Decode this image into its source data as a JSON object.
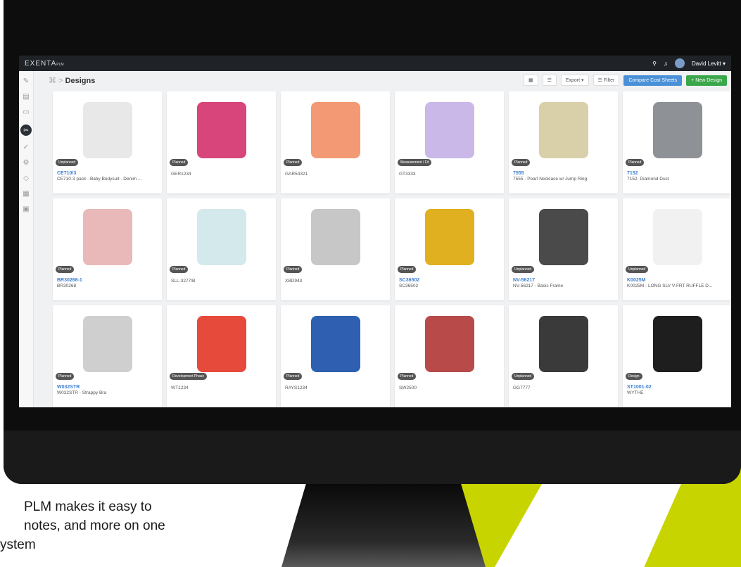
{
  "colors": {
    "accent_blue": "#4a90d9",
    "accent_green": "#3aa74a",
    "stripe": "#c8d400",
    "badge": "#555555"
  },
  "app": {
    "logo": "EXENTA",
    "logo_sub": "PLM",
    "user": "David Levitt ▾"
  },
  "breadcrumb": {
    "icon": "⌘",
    "sep": ">",
    "title": "Designs"
  },
  "toolbar": {
    "grid_icon": "▦",
    "list_icon": "☰",
    "export": "Export ▾",
    "filter": "☰ Filter",
    "compare": "Compare Cost Sheets",
    "new_design": "+ New Design"
  },
  "sidebar": {
    "icons": [
      "pen-icon",
      "docs-icon",
      "image-icon",
      "scissors-icon",
      "check-icon",
      "gear-icon",
      "tag-icon",
      "grid-icon",
      "report-icon"
    ]
  },
  "caption": {
    "line1": "PLM makes it easy to",
    "line2": "notes, and more on one",
    "line3": "ystem"
  },
  "cards": [
    {
      "badge": "Unplanned",
      "code": "CE710/3",
      "desc": "CE710-3 pack - Baby Bodysuit - Denim ...",
      "color": "#e8e8e8"
    },
    {
      "badge": "Planned",
      "code": "",
      "desc": "GER1234",
      "color": "#d8457a"
    },
    {
      "badge": "Planned",
      "code": "",
      "desc": "GAR54321",
      "color": "#f39a74"
    },
    {
      "badge": "Measurement / Fit",
      "code": "",
      "desc": "GT3333",
      "color": "#c9b8e8"
    },
    {
      "badge": "Planned",
      "code": "7555",
      "desc": "7555 - Pearl Necklace w/ Jump Ring",
      "color": "#d9cfa8"
    },
    {
      "badge": "Planned",
      "code": "7152",
      "desc": "7152- Diamond Dust",
      "color": "#8e9196"
    },
    {
      "badge": "Planned",
      "code": "BR30268-1",
      "desc": "BR30268",
      "color": "#e9b8b8"
    },
    {
      "badge": "Planned",
      "code": "",
      "desc": "SLL-3277/B",
      "color": "#d4e9ec"
    },
    {
      "badge": "Planned",
      "code": "",
      "desc": "XBD943",
      "color": "#c7c7c7"
    },
    {
      "badge": "Planned",
      "code": "SC36502",
      "desc": "SC36502",
      "color": "#e0b020"
    },
    {
      "badge": "Unplanned",
      "code": "NV-56217",
      "desc": "NV-56217 - Basic Frame",
      "color": "#4a4a4a"
    },
    {
      "badge": "Unplanned",
      "code": "K0025M",
      "desc": "K0025M - LONG SLV V-FRT RUFFLE D...",
      "color": "#f1f1f1"
    },
    {
      "badge": "Planned",
      "code": "W032STR",
      "desc": "W032STR - Strappy Bra",
      "color": "#cfcfcf"
    },
    {
      "badge": "Development Phase",
      "code": "",
      "desc": "WT1234",
      "color": "#e64a3b"
    },
    {
      "badge": "Planned",
      "code": "",
      "desc": "RAYS1234",
      "color": "#2f5fb0"
    },
    {
      "badge": "Planned",
      "code": "",
      "desc": "SW2500",
      "color": "#b84a4a"
    },
    {
      "badge": "Unplanned",
      "code": "",
      "desc": "GG7777",
      "color": "#3a3a3a"
    },
    {
      "badge": "Design",
      "code": "ST1001-02",
      "desc": "WYTHE",
      "color": "#1e1e1e"
    }
  ]
}
